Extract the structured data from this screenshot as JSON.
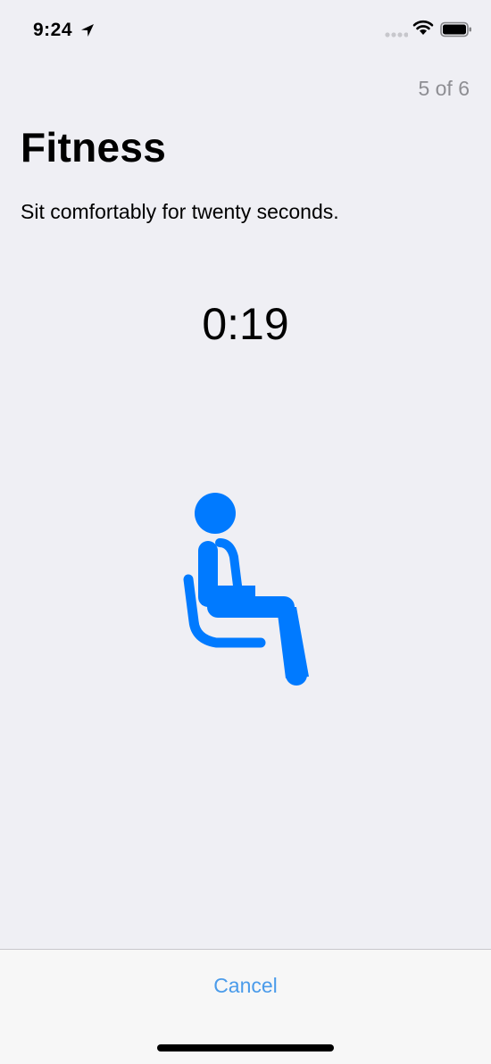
{
  "status_bar": {
    "time": "9:24",
    "icons": [
      "location-arrow-icon",
      "cellular-signal-icon",
      "wifi-icon",
      "battery-icon"
    ]
  },
  "header": {
    "step_counter": "5 of 6"
  },
  "main": {
    "title": "Fitness",
    "instruction": "Sit comfortably for twenty seconds.",
    "countdown": "0:19",
    "illustration_icon": "seated-person-icon"
  },
  "footer": {
    "cancel_label": "Cancel"
  },
  "colors": {
    "accent": "#007AFF",
    "background": "#EFEFF4",
    "secondary_text": "#8E8E93",
    "footer_background": "#F7F7F7"
  }
}
